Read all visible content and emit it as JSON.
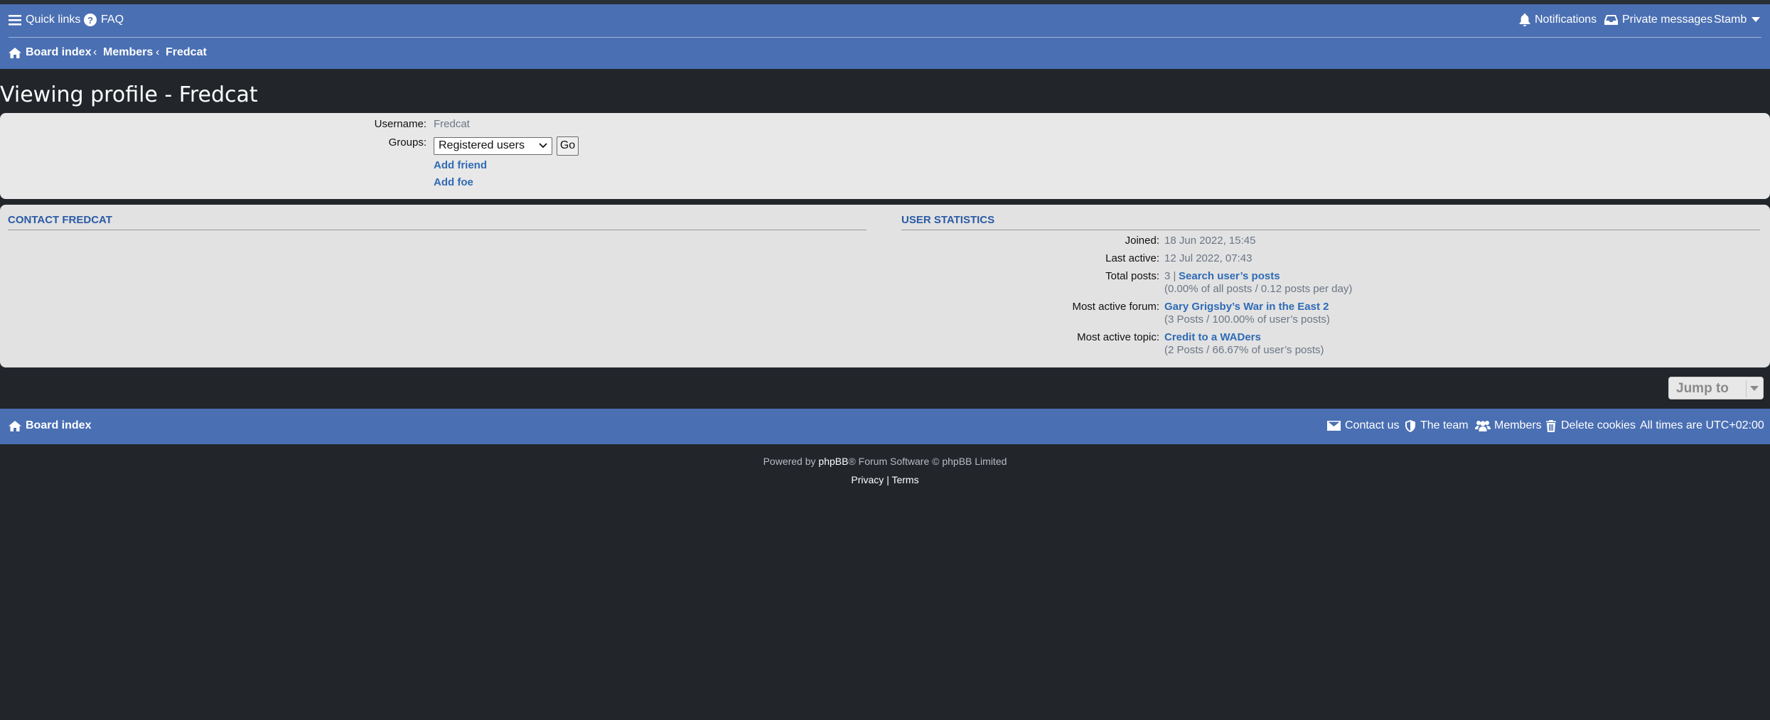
{
  "header": {
    "quick_links": "Quick links",
    "faq": "FAQ",
    "notifications": "Notifications",
    "private_messages": "Private messages",
    "user": "Stamb"
  },
  "breadcrumb": {
    "items": [
      "Board index",
      "Members",
      "Fredcat"
    ]
  },
  "page_title": "Viewing profile - Fredcat",
  "profile": {
    "username_label": "Username:",
    "username_value": "Fredcat",
    "groups_label": "Groups:",
    "groups_selected": "Registered users",
    "go_label": "Go",
    "add_friend": "Add friend",
    "add_foe": "Add foe"
  },
  "contact": {
    "heading": "CONTACT FREDCAT"
  },
  "stats": {
    "heading": "USER STATISTICS",
    "joined_label": "Joined:",
    "joined_value": "18 Jun 2022, 15:45",
    "last_active_label": "Last active:",
    "last_active_value": "12 Jul 2022, 07:43",
    "total_posts_label": "Total posts:",
    "total_posts_count": "3 |",
    "search_posts_link": "Search user’s posts",
    "total_posts_detail": "(0.00% of all posts / 0.12 posts per day)",
    "most_active_forum_label": "Most active forum:",
    "most_active_forum_link": "Gary Grigsby’s War in the East 2",
    "most_active_forum_detail": "(3 Posts / 100.00% of user’s posts)",
    "most_active_topic_label": "Most active topic:",
    "most_active_topic_link": "Credit to a WADers",
    "most_active_topic_detail": "(2 Posts / 66.67% of user’s posts)"
  },
  "jump_to": "Jump to",
  "footer": {
    "board_index": "Board index",
    "contact_us": "Contact us",
    "the_team": "The team",
    "members": "Members",
    "delete_cookies": "Delete cookies",
    "timezone": "All times are UTC+02:00",
    "powered_by": "Powered by",
    "phpbb": "phpBB",
    "software": "® Forum Software © phpBB Limited",
    "privacy": "Privacy",
    "pipe": "|",
    "terms": "Terms"
  },
  "colors": {
    "navbar": "#4a6fb3",
    "background": "#22262b",
    "panel": "#e8e8e8",
    "link": "#2f6bb5"
  }
}
